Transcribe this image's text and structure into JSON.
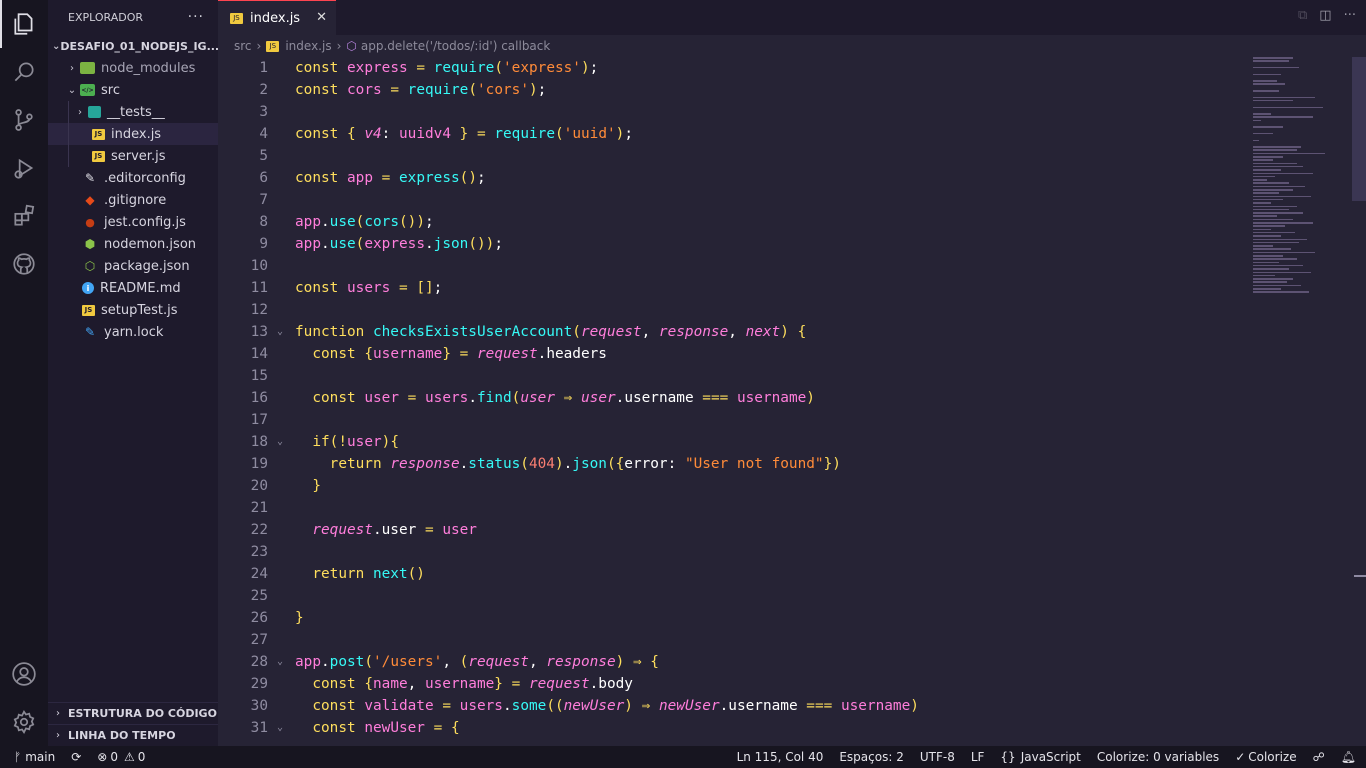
{
  "sidebar": {
    "title": "EXPLORADOR",
    "more": "···",
    "root": "DESAFIO_01_NODEJS_IG...",
    "items": [
      {
        "label": "node_modules",
        "chev": "›",
        "icon": "folder-node-icon"
      },
      {
        "label": "src",
        "chev": "⌄",
        "icon": "folder-src-icon"
      },
      {
        "label": "__tests__",
        "chev": "›",
        "icon": "folder-test-icon"
      },
      {
        "label": "index.js",
        "icon": "js-icon"
      },
      {
        "label": "server.js",
        "icon": "js-icon"
      },
      {
        "label": ".editorconfig",
        "icon": "editorconfig-icon"
      },
      {
        "label": ".gitignore",
        "icon": "git-icon"
      },
      {
        "label": "jest.config.js",
        "icon": "jest-icon"
      },
      {
        "label": "nodemon.json",
        "icon": "nodemon-icon"
      },
      {
        "label": "package.json",
        "icon": "nodejs-icon"
      },
      {
        "label": "README.md",
        "icon": "info-icon"
      },
      {
        "label": "setupTest.js",
        "icon": "js-icon"
      },
      {
        "label": "yarn.lock",
        "icon": "yarn-icon"
      }
    ],
    "outline": "ESTRUTURA DO CÓDIGO",
    "timeline": "LINHA DO TEMPO"
  },
  "tab": {
    "label": "index.js",
    "icon_text": "JS",
    "close": "✕"
  },
  "breadcrumb": {
    "folder": "src",
    "file": "index.js",
    "symbol": "app.delete('/todos/:id') callback"
  },
  "editor": {
    "line_numbers": [
      "1",
      "2",
      "3",
      "4",
      "5",
      "6",
      "7",
      "8",
      "9",
      "10",
      "11",
      "12",
      "13",
      "14",
      "15",
      "16",
      "17",
      "18",
      "19",
      "20",
      "21",
      "22",
      "23",
      "24",
      "25",
      "26",
      "27",
      "28",
      "29",
      "30",
      "31"
    ]
  },
  "statusbar": {
    "branch": "main",
    "errors": "0",
    "warnings": "0",
    "position": "Ln 115, Col 40",
    "spaces": "Espaços: 2",
    "encoding": "UTF-8",
    "eol": "LF",
    "language": "JavaScript",
    "colorize_vars": "Colorize: 0 variables",
    "colorize": "Colorize"
  },
  "colors": {
    "accent": "#fe4450",
    "background": "#262335",
    "sidebar": "#1e1a2c",
    "keyword": "#fede5d",
    "function": "#36f9f6",
    "string": "#ff8b39",
    "variable": "#ff7edb"
  }
}
